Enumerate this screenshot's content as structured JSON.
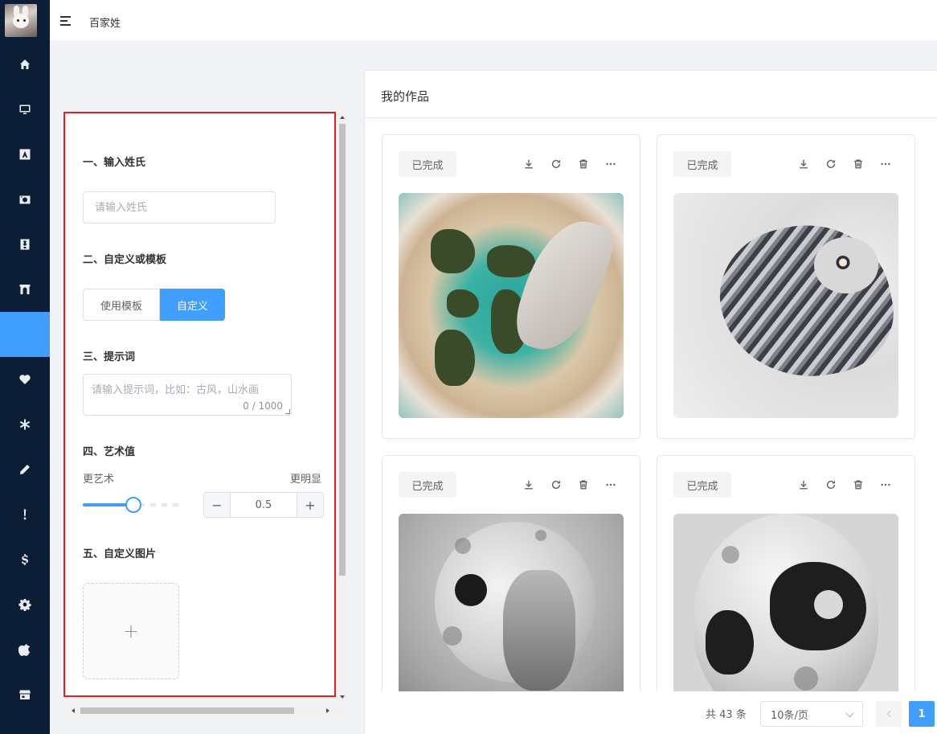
{
  "header": {
    "breadcrumb": "百家姓"
  },
  "nav": {
    "items": [
      {
        "icon": "home-icon"
      },
      {
        "icon": "monitor-icon"
      },
      {
        "icon": "font-a-icon"
      },
      {
        "icon": "camera-icon"
      },
      {
        "icon": "certificate-icon"
      },
      {
        "icon": "archway-icon"
      },
      {
        "icon": "active-blank-item"
      },
      {
        "icon": "heart-icon"
      },
      {
        "icon": "asterisk-icon"
      },
      {
        "icon": "pencil-icon"
      },
      {
        "icon": "exclamation-icon"
      },
      {
        "icon": "dollar-icon"
      },
      {
        "icon": "gear-icon"
      },
      {
        "icon": "apple-icon"
      },
      {
        "icon": "store-icon"
      }
    ],
    "active_index": 6,
    "active_color": "#409eff",
    "background": "#0c1e35"
  },
  "form": {
    "step1_title": "一、输入姓氏",
    "surname_placeholder": "请输入姓氏",
    "step2_title": "二、自定义或模板",
    "template_label": "使用模板",
    "custom_label": "自定义",
    "step3_title": "三、提示词",
    "prompt_placeholder": "请输入提示词，比如：古风，山水画",
    "prompt_count": "0 / 1000",
    "step4_title": "四、艺术值",
    "more_art_label": "更艺术",
    "more_clear_label": "更明显",
    "art_value": "0.5",
    "art_value_fraction": 0.5,
    "step5_title": "五、自定义图片",
    "upload_plus": "+"
  },
  "works": {
    "title": "我的作品",
    "cards": [
      {
        "status": "已完成",
        "image": "aerial-island-with-bird-wing"
      },
      {
        "status": "已完成",
        "image": "feathered-bird-sculpture"
      },
      {
        "status": "已完成",
        "image": "moon-head-portrait"
      },
      {
        "status": "已完成",
        "image": "cratered-moon-skull"
      }
    ],
    "actions": [
      "download-icon",
      "refresh-icon",
      "trash-icon",
      "more-icon"
    ],
    "pagination": {
      "total_text": "共 43 条",
      "page_size": "10条/页",
      "current_page": "1"
    }
  },
  "colors": {
    "accent": "#409eff",
    "highlight_frame": "#ee1c1c"
  }
}
